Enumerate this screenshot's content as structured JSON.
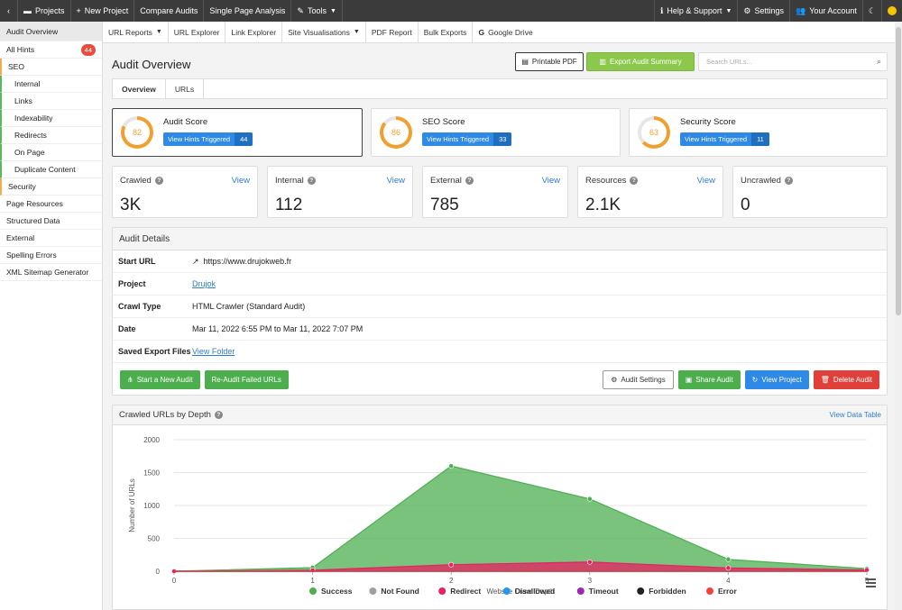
{
  "topbar": {
    "projects": "Projects",
    "new_project": "New Project",
    "compare_audits": "Compare Audits",
    "single_page_analysis": "Single Page Analysis",
    "tools": "Tools",
    "help_support": "Help & Support",
    "settings": "Settings",
    "your_account": "Your Account"
  },
  "sidebar": {
    "items": [
      {
        "label": "Audit Overview"
      },
      {
        "label": "All Hints",
        "badge": "44"
      },
      {
        "label": "SEO"
      },
      {
        "label": "Internal"
      },
      {
        "label": "Links"
      },
      {
        "label": "Indexability"
      },
      {
        "label": "Redirects"
      },
      {
        "label": "On Page"
      },
      {
        "label": "Duplicate Content"
      },
      {
        "label": "Security"
      },
      {
        "label": "Page Resources"
      },
      {
        "label": "Structured Data"
      },
      {
        "label": "External"
      },
      {
        "label": "Spelling Errors"
      },
      {
        "label": "XML Sitemap Generator"
      }
    ]
  },
  "subnav": {
    "items": [
      "URL Reports",
      "URL Explorer",
      "Link Explorer",
      "Site Visualisations",
      "PDF Report",
      "Bulk Exports",
      "Google Drive"
    ]
  },
  "main": {
    "title": "Audit Overview",
    "printable_pdf": "Printable PDF",
    "export_summary": "Export Audit Summary",
    "search_placeholder": "Search URLs...",
    "tabs": [
      "Overview",
      "URLs"
    ]
  },
  "scores": [
    {
      "title": "Audit Score",
      "value": "82",
      "button": "View Hints Triggered",
      "count": "44"
    },
    {
      "title": "SEO Score",
      "value": "86",
      "button": "View Hints Triggered",
      "count": "33"
    },
    {
      "title": "Security Score",
      "value": "63",
      "button": "View Hints Triggered",
      "count": "11"
    }
  ],
  "stats": [
    {
      "label": "Crawled",
      "value": "3K",
      "view": "View"
    },
    {
      "label": "Internal",
      "value": "112",
      "view": "View"
    },
    {
      "label": "External",
      "value": "785",
      "view": "View"
    },
    {
      "label": "Resources",
      "value": "2.1K",
      "view": "View"
    },
    {
      "label": "Uncrawled",
      "value": "0"
    }
  ],
  "details": {
    "heading": "Audit Details",
    "rows": [
      {
        "key": "Start URL",
        "value": "https://www.drujokweb.fr"
      },
      {
        "key": "Project",
        "value": "Drujok"
      },
      {
        "key": "Crawl Type",
        "value": "HTML Crawler (Standard Audit)"
      },
      {
        "key": "Date",
        "value": "Mar 11, 2022 6:55 PM to Mar 11, 2022 7:07 PM"
      },
      {
        "key": "Saved Export Files",
        "value": "View Folder"
      }
    ],
    "actions": {
      "start_new": "Start a New Audit",
      "reaudit": "Re-Audit Failed URLs",
      "audit_settings": "Audit Settings",
      "share": "Share Audit",
      "view_project": "View Project",
      "delete": "Delete Audit"
    }
  },
  "chart_panel": {
    "title": "Crawled URLs by Depth",
    "view_table": "View Data Table"
  },
  "chart_data": {
    "type": "area",
    "xlabel": "Website Crawl Depth",
    "ylabel": "Number of URLs",
    "x": [
      0,
      1,
      2,
      3,
      4,
      5
    ],
    "ylim": [
      0,
      2000
    ],
    "yticks": [
      0,
      500,
      1000,
      1500,
      2000
    ],
    "grid": true,
    "legend_position": "bottom",
    "series": [
      {
        "name": "Success",
        "color": "#4caf50",
        "values": [
          1,
          55,
          1600,
          1100,
          180,
          40
        ]
      },
      {
        "name": "Not Found",
        "color": "#9e9e9e",
        "values": [
          0,
          0,
          0,
          0,
          0,
          0
        ]
      },
      {
        "name": "Redirect",
        "color": "#e91e63",
        "values": [
          0,
          15,
          100,
          140,
          50,
          20
        ]
      },
      {
        "name": "Disallowed",
        "color": "#2196f3",
        "values": [
          0,
          0,
          0,
          0,
          0,
          0
        ]
      },
      {
        "name": "Timeout",
        "color": "#9c27b0",
        "values": [
          0,
          0,
          0,
          0,
          0,
          0
        ]
      },
      {
        "name": "Forbidden",
        "color": "#222222",
        "values": [
          0,
          0,
          0,
          0,
          0,
          0
        ]
      },
      {
        "name": "Error",
        "color": "#f44336",
        "values": [
          0,
          0,
          0,
          0,
          0,
          0
        ]
      }
    ]
  }
}
